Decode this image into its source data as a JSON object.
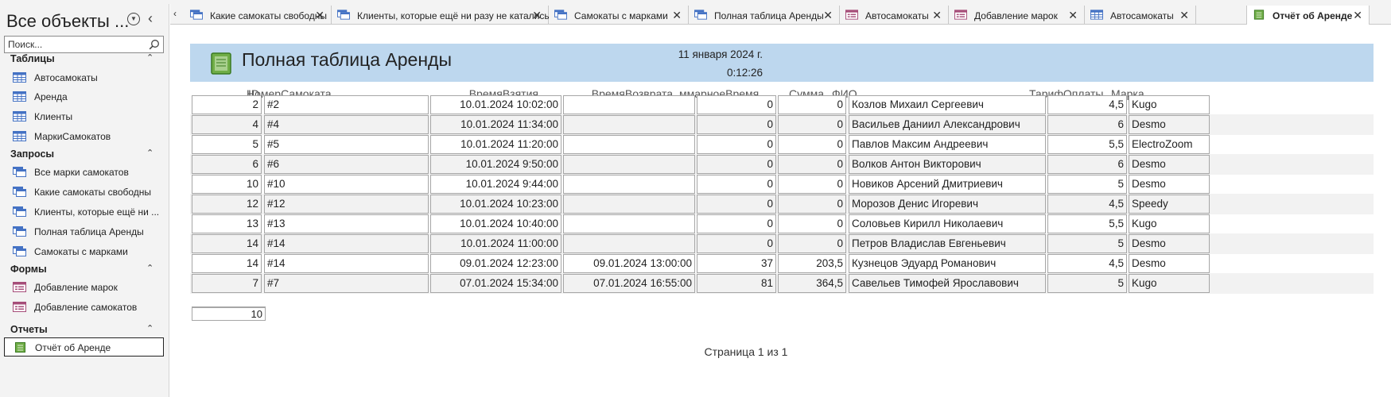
{
  "nav": {
    "title": "Все объекты ...",
    "search_placeholder": "Поиск...",
    "groups": {
      "tables": {
        "label": "Таблицы",
        "items": [
          "Автосамокаты",
          "Аренда",
          "Клиенты",
          "МаркиСамокатов"
        ]
      },
      "queries": {
        "label": "Запросы",
        "items": [
          "Все марки самокатов",
          "Какие самокаты свободны",
          "Клиенты, которые ещё ни ...",
          "Полная таблица Аренды",
          "Самокаты с марками"
        ]
      },
      "forms": {
        "label": "Формы",
        "items": [
          "Добавление марок",
          "Добавление самокатов"
        ]
      },
      "reports": {
        "label": "Отчеты",
        "items": [
          "Отчёт об Аренде"
        ]
      }
    }
  },
  "tabs": [
    {
      "label": "Какие самокаты свободны",
      "icon": "query-icon"
    },
    {
      "label": "Клиенты, которые ещё ни разу не катались",
      "icon": "query-icon"
    },
    {
      "label": "Самокаты с марками",
      "icon": "query-icon"
    },
    {
      "label": "Полная таблица Аренды",
      "icon": "query-icon"
    },
    {
      "label": "Автосамокаты",
      "icon": "form-icon"
    },
    {
      "label": "Добавление марок",
      "icon": "form-icon"
    },
    {
      "label": "Автосамокаты",
      "icon": "table-icon"
    },
    {
      "label": "Отчёт об Аренде",
      "icon": "report-icon",
      "active": true
    }
  ],
  "report": {
    "title": "Полная таблица Аренды",
    "date": "11 января 2024 г.",
    "time": "0:12:26",
    "columns": {
      "id": "ID",
      "scooter": "НомерСамоката",
      "taken": "ВремяВзятия",
      "returned": "ВремяВозврата",
      "total_time": "ммарноеВремя",
      "sum": "Сумма",
      "fio": "ФИО",
      "tariff": "ТарифОплаты",
      "brand": "Марка"
    },
    "rows": [
      {
        "id": "2",
        "scooter": "#2",
        "taken": "10.01.2024 10:02:00",
        "returned": "",
        "total_time": "0",
        "sum": "0",
        "fio": "Козлов Михаил Сергеевич",
        "tariff": "4,5",
        "brand": "Kugo"
      },
      {
        "id": "4",
        "scooter": "#4",
        "taken": "10.01.2024 11:34:00",
        "returned": "",
        "total_time": "0",
        "sum": "0",
        "fio": "Васильев Даниил Александрович",
        "tariff": "6",
        "brand": "Desmo"
      },
      {
        "id": "5",
        "scooter": "#5",
        "taken": "10.01.2024 11:20:00",
        "returned": "",
        "total_time": "0",
        "sum": "0",
        "fio": "Павлов Максим Андреевич",
        "tariff": "5,5",
        "brand": "ElectroZoom"
      },
      {
        "id": "6",
        "scooter": "#6",
        "taken": "10.01.2024 9:50:00",
        "returned": "",
        "total_time": "0",
        "sum": "0",
        "fio": "Волков Антон Викторович",
        "tariff": "6",
        "brand": "Desmo"
      },
      {
        "id": "10",
        "scooter": "#10",
        "taken": "10.01.2024 9:44:00",
        "returned": "",
        "total_time": "0",
        "sum": "0",
        "fio": "Новиков Арсений Дмитриевич",
        "tariff": "5",
        "brand": "Desmo"
      },
      {
        "id": "12",
        "scooter": "#12",
        "taken": "10.01.2024 10:23:00",
        "returned": "",
        "total_time": "0",
        "sum": "0",
        "fio": "Морозов Денис Игоревич",
        "tariff": "4,5",
        "brand": "Speedy"
      },
      {
        "id": "13",
        "scooter": "#13",
        "taken": "10.01.2024 10:40:00",
        "returned": "",
        "total_time": "0",
        "sum": "0",
        "fio": "Соловьев Кирилл Николаевич",
        "tariff": "5,5",
        "brand": "Kugo"
      },
      {
        "id": "14",
        "scooter": "#14",
        "taken": "10.01.2024 11:00:00",
        "returned": "",
        "total_time": "0",
        "sum": "0",
        "fio": "Петров Владислав Евгеньевич",
        "tariff": "5",
        "brand": "Desmo"
      },
      {
        "id": "14",
        "scooter": "#14",
        "taken": "09.01.2024 12:23:00",
        "returned": "09.01.2024 13:00:00",
        "total_time": "37",
        "sum": "203,5",
        "fio": "Кузнецов Эдуард Романович",
        "tariff": "4,5",
        "brand": "Desmo"
      },
      {
        "id": "7",
        "scooter": "#7",
        "taken": "07.01.2024 15:34:00",
        "returned": "07.01.2024 16:55:00",
        "total_time": "81",
        "sum": "364,5",
        "fio": "Савельев Тимофей Ярославович",
        "tariff": "5",
        "brand": "Kugo"
      }
    ],
    "count": "10",
    "page_footer": "Страница 1 из 1"
  },
  "colors": {
    "header_band": "#bdd7ee",
    "nav_bg": "#f3f3f3",
    "row_alt": "#f2f2f2",
    "cell_border": "#a6a6a6"
  }
}
